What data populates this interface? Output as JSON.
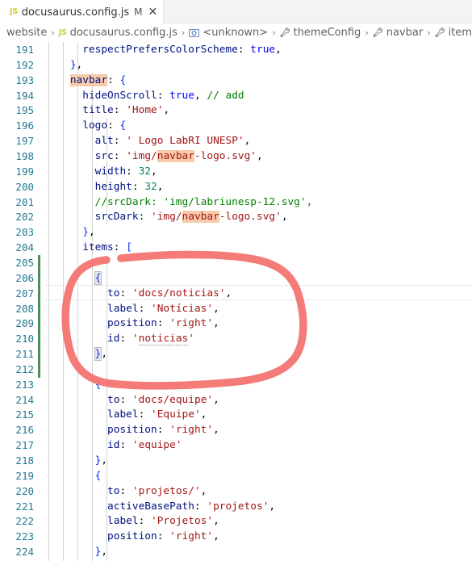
{
  "tab": {
    "icon": "js-file-icon",
    "filename": "docusaurus.config.js",
    "dirty_marker": "M",
    "close_label": "✕"
  },
  "breadcrumb": {
    "separator": "›",
    "items": [
      {
        "label": "website",
        "icon": ""
      },
      {
        "label": "docusaurus.config.js",
        "icon": "js-file-icon"
      },
      {
        "label": "<unknown>",
        "icon": "symbol-object-icon"
      },
      {
        "label": "themeConfig",
        "icon": "wrench-icon"
      },
      {
        "label": "navbar",
        "icon": "wrench-icon"
      },
      {
        "label": "items",
        "icon": "wrench-icon"
      }
    ]
  },
  "editor": {
    "first_line_number": 191,
    "last_line_number": 224,
    "current_line": 207,
    "find_match_term": "navbar",
    "git_changed_lines": [
      205,
      206,
      207,
      208,
      209,
      210,
      211,
      212
    ],
    "lines": [
      {
        "n": 191,
        "text": "      respectPrefersColorScheme: true,"
      },
      {
        "n": 192,
        "text": "    },"
      },
      {
        "n": 193,
        "text": "    navbar: {"
      },
      {
        "n": 194,
        "text": "      hideOnScroll: true, // add"
      },
      {
        "n": 195,
        "text": "      title: 'Home',"
      },
      {
        "n": 196,
        "text": "      logo: {"
      },
      {
        "n": 197,
        "text": "        alt: ' Logo LabRI UNESP',"
      },
      {
        "n": 198,
        "text": "        src: 'img/navbar-logo.svg',"
      },
      {
        "n": 199,
        "text": "        width: 32,"
      },
      {
        "n": 200,
        "text": "        height: 32,"
      },
      {
        "n": 201,
        "text": "        //srcDark: 'img/labriunesp-12.svg',"
      },
      {
        "n": 202,
        "text": "        srcDark: 'img/navbar-logo.svg',"
      },
      {
        "n": 203,
        "text": "      },"
      },
      {
        "n": 204,
        "text": "      items: ["
      },
      {
        "n": 205,
        "text": ""
      },
      {
        "n": 206,
        "text": "        {"
      },
      {
        "n": 207,
        "text": "          to: 'docs/noticias',"
      },
      {
        "n": 208,
        "text": "          label: 'Notícias',"
      },
      {
        "n": 209,
        "text": "          position: 'right',"
      },
      {
        "n": 210,
        "text": "          id: 'noticias'"
      },
      {
        "n": 211,
        "text": "        },"
      },
      {
        "n": 212,
        "text": ""
      },
      {
        "n": 213,
        "text": "        {"
      },
      {
        "n": 214,
        "text": "          to: 'docs/equipe',"
      },
      {
        "n": 215,
        "text": "          label: 'Equipe',"
      },
      {
        "n": 216,
        "text": "          position: 'right',"
      },
      {
        "n": 217,
        "text": "          id: 'equipe'"
      },
      {
        "n": 218,
        "text": "        },"
      },
      {
        "n": 219,
        "text": "        {"
      },
      {
        "n": 220,
        "text": "          to: 'projetos/',"
      },
      {
        "n": 221,
        "text": "          activeBasePath: 'projetos',"
      },
      {
        "n": 222,
        "text": "          label: 'Projetos',"
      },
      {
        "n": 223,
        "text": "          position: 'right',"
      },
      {
        "n": 224,
        "text": "        },"
      }
    ]
  },
  "annotation": {
    "type": "hand-drawn-ellipse",
    "color": "#f4706e",
    "stroke_width": 9,
    "encircled_lines": [
      206,
      207,
      208,
      209,
      210,
      211
    ]
  },
  "colors": {
    "keyword": "#0000ff",
    "string": "#a31515",
    "comment": "#008000",
    "property": "#001080",
    "number": "#098658",
    "line_number": "#237893",
    "find_highlight": "#f8cbaa",
    "git_added": "#4a8f5b",
    "annotation": "#f4706e"
  }
}
